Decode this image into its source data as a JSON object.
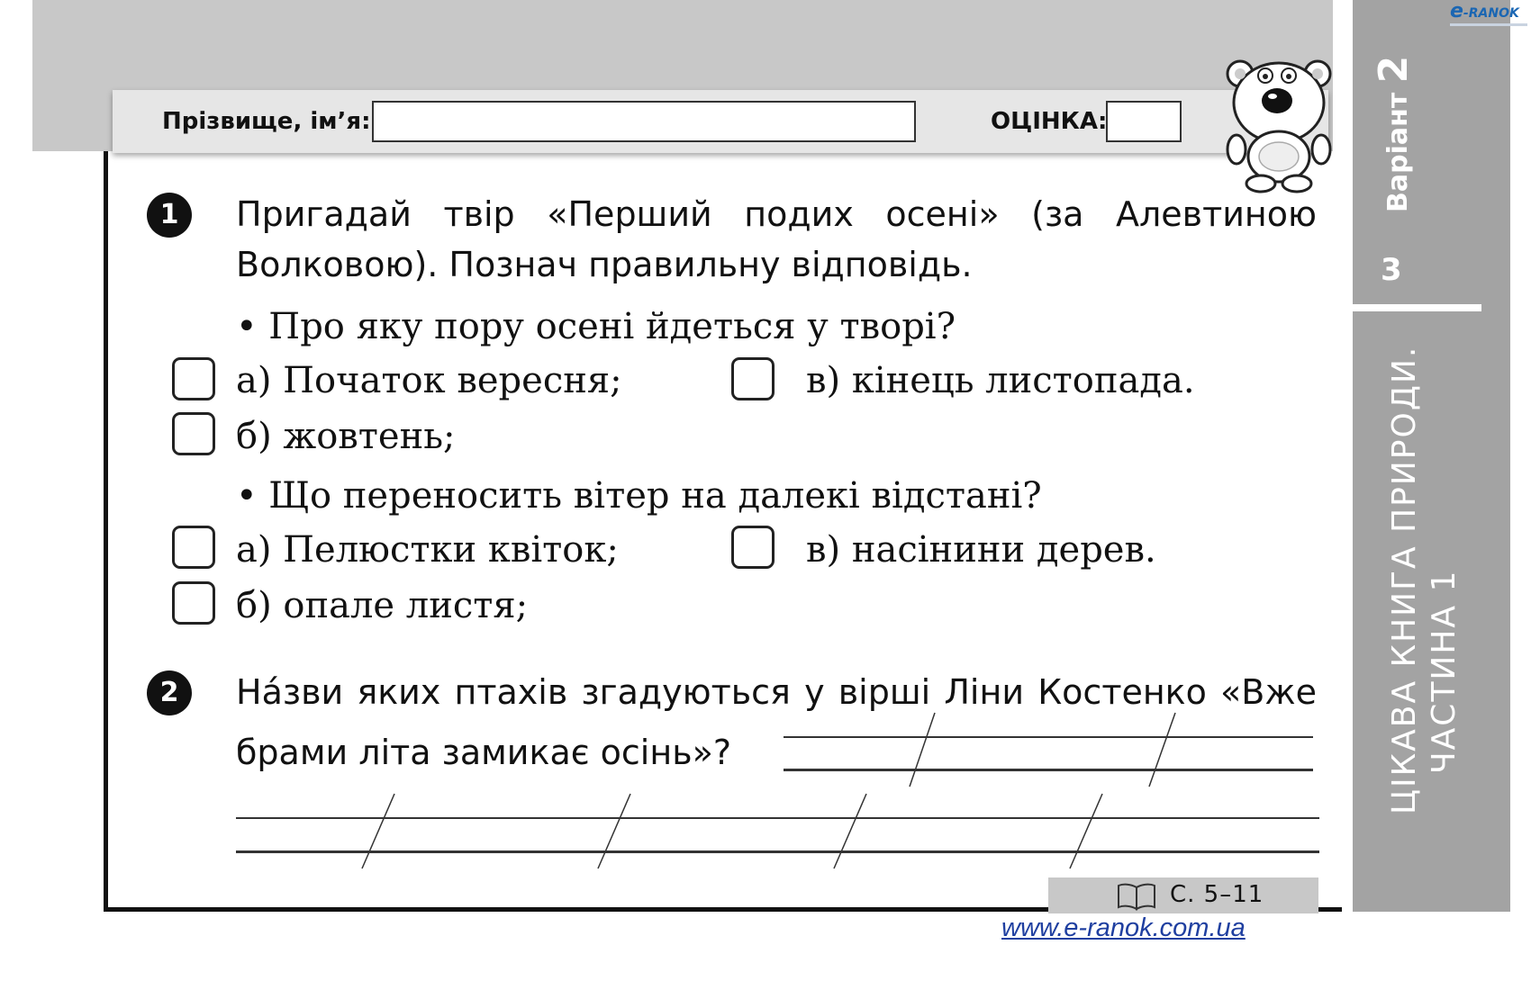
{
  "header": {
    "name_label": "Прізвище, ім’я:",
    "name_value": "",
    "grade_label": "ОЦІНКА:",
    "grade_value": ""
  },
  "sidebar": {
    "variant_label": "Варіант",
    "variant_number": "2",
    "page_number": "3",
    "book_title_line1": "ЦІКАВА КНИГА ПРИРОДИ.",
    "book_title_line2": "ЧАСТИНА 1"
  },
  "logo": {
    "e": "e",
    "text": "-RANOK"
  },
  "question1": {
    "number": "1",
    "line1": "Пригадай твір «Перший подих осені» (за Алевтиною",
    "line2": "Волковою). Познач правильну відповідь.",
    "sub1": {
      "question": "• Про яку пору осені йдеться у творі?",
      "option_a": "а) Початок вересня;",
      "option_b": "б) жовтень;",
      "option_v": "в) кінець листопада."
    },
    "sub2": {
      "question": "• Що переносить вітер на далекі відстані?",
      "option_a": "а) Пелюстки квіток;",
      "option_b": "б) опале листя;",
      "option_v": "в) насінини дерев."
    }
  },
  "question2": {
    "number": "2",
    "line1": "Нáзви яких птахів згадуються у вірші Ліни Костенко «Вже",
    "line2": "брами літа замикає осінь»?"
  },
  "footer": {
    "page_ref": "С. 5–11",
    "url": "www.e-ranok.com.ua"
  }
}
